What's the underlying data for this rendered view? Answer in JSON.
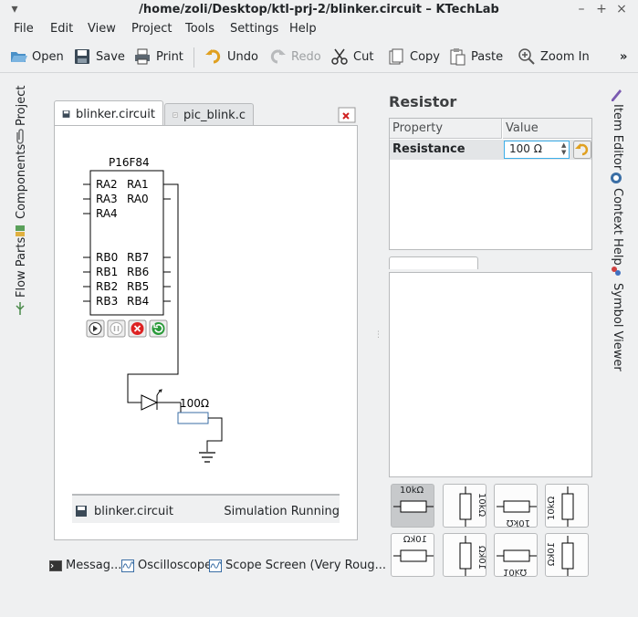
{
  "window": {
    "title": "/home/zoli/Desktop/ktl-prj-2/blinker.circuit – KTechLab",
    "menu_glyph": "▾",
    "minimize_glyph": "–",
    "maximize_glyph": "+",
    "close_glyph": "×"
  },
  "menu": [
    "File",
    "Edit",
    "View",
    "Project",
    "Tools",
    "Settings",
    "Help"
  ],
  "toolbar": {
    "open": "Open",
    "save": "Save",
    "print": "Print",
    "undo": "Undo",
    "redo": "Redo",
    "cut": "Cut",
    "copy": "Copy",
    "paste": "Paste",
    "zoom_in": "Zoom In",
    "overflow": "»"
  },
  "left_sidebar": {
    "project": "Project",
    "components": "Components",
    "flow_parts": "Flow Parts"
  },
  "right_sidebar": {
    "item_editor": "Item Editor",
    "context_help": "Context Help",
    "symbol_viewer": "Symbol Viewer"
  },
  "tabs": {
    "active": "blinker.circuit",
    "inactive": "pic_blink.c"
  },
  "circuit": {
    "chip_name": "P16F84",
    "left_pins": [
      "RA2",
      "RA3",
      "RA4",
      "",
      "",
      "RB0",
      "RB1",
      "RB2",
      "RB3"
    ],
    "right_pins": [
      "RA1",
      "RA0",
      "",
      "",
      "",
      "RB7",
      "RB6",
      "RB5",
      "RB4"
    ],
    "resistor_label": "100Ω"
  },
  "doc_status": {
    "file": "blinker.circuit",
    "state": "Simulation Running"
  },
  "bottom_tabs": {
    "messages": "Messag...",
    "oscilloscope": "Oscilloscope",
    "scope_screen": "Scope Screen (Very Roug..."
  },
  "item_editor": {
    "title": "Resistor",
    "col_property": "Property",
    "col_value": "Value",
    "property": "Resistance",
    "value": "100 Ω",
    "spin_up": "▲",
    "spin_down": "▼"
  },
  "orientations": {
    "label": "10kΩ"
  }
}
